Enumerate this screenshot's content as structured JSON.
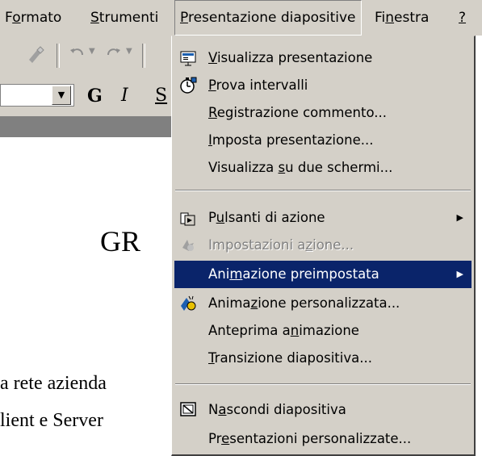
{
  "menubar": {
    "formato": {
      "pre": "F",
      "u": "o",
      "post": "rmato"
    },
    "strumenti": {
      "pre": "",
      "u": "S",
      "post": "trumenti"
    },
    "presentazione": {
      "pre": "",
      "u": "P",
      "post": "resentazione diapositive"
    },
    "finestra": {
      "pre": "Fi",
      "u": "n",
      "post": "estra"
    },
    "help": {
      "pre": "",
      "u": "?",
      "post": ""
    }
  },
  "toolbar": {
    "bold": "G",
    "italic": "I",
    "underline": "S"
  },
  "document": {
    "title_fragment": "GR",
    "line1": "a rete azienda",
    "line2": "lient e Server"
  },
  "menu": {
    "items": [
      {
        "pre": "",
        "u": "V",
        "post": "isualizza presentazione",
        "icon": "slideshow-icon"
      },
      {
        "pre": "",
        "u": "P",
        "post": "rova intervalli",
        "icon": "stopwatch-icon"
      },
      {
        "pre": "",
        "u": "R",
        "post": "egistrazione commento..."
      },
      {
        "pre": "",
        "u": "I",
        "post": "mposta presentazione..."
      },
      {
        "pre": "Visualizza ",
        "u": "s",
        "post": "u due schermi..."
      },
      {
        "pre": "P",
        "u": "u",
        "post": "lsanti di azione",
        "icon": "action-button-icon",
        "submenu": true
      },
      {
        "pre": "Impostazioni a",
        "u": "z",
        "post": "ione...",
        "icon": "action-settings-icon",
        "disabled": true
      },
      {
        "pre": "Ani",
        "u": "m",
        "post": "azione preimpostata",
        "submenu": true,
        "selected": true
      },
      {
        "pre": "Anima",
        "u": "z",
        "post": "ione personalizzata...",
        "icon": "custom-animation-icon"
      },
      {
        "pre": "Anteprima a",
        "u": "n",
        "post": "imazione"
      },
      {
        "pre": "",
        "u": "T",
        "post": "ransizione diapositiva..."
      },
      {
        "pre": "N",
        "u": "a",
        "post": "scondi diapositiva",
        "icon": "hide-slide-icon"
      },
      {
        "pre": "Pr",
        "u": "e",
        "post": "sentazioni personalizzate..."
      }
    ]
  }
}
